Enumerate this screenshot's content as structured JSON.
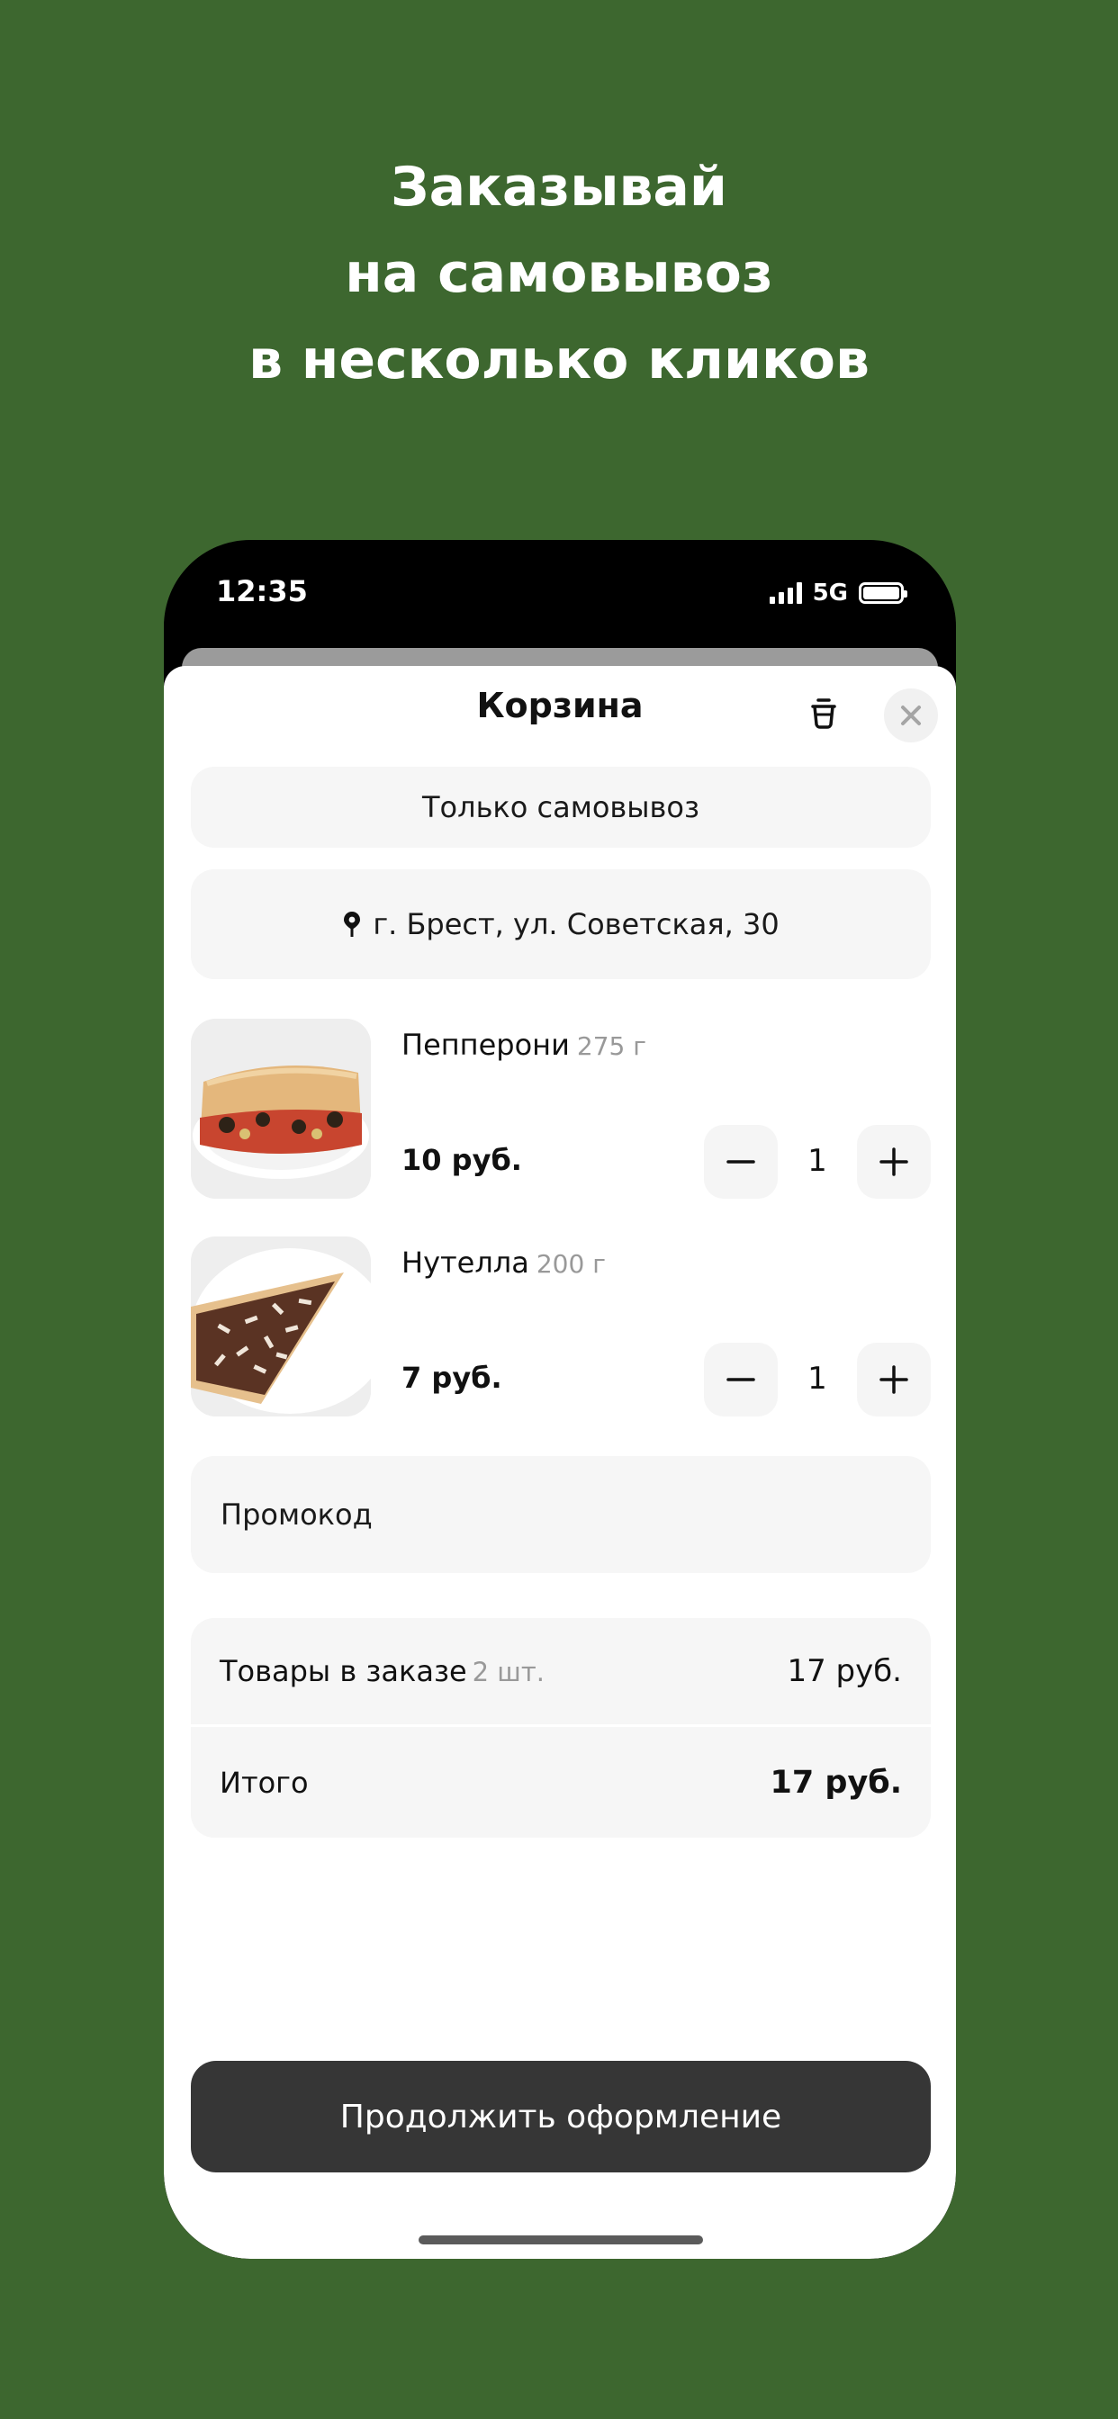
{
  "headline": {
    "line1": "Заказывай",
    "line2": "на самовывоз",
    "line3": "в несколько кликов"
  },
  "status_bar": {
    "time": "12:35",
    "network": "5G"
  },
  "cart": {
    "title": "Корзина",
    "pickup_notice": "Только самовывоз",
    "address": "г. Брест, ул. Советская, 30",
    "items": [
      {
        "name": "Пепперони",
        "weight": "275 г",
        "price": "10 руб.",
        "quantity": "1"
      },
      {
        "name": "Нутелла",
        "weight": "200 г",
        "price": "7 руб.",
        "quantity": "1"
      }
    ],
    "promo_label": "Промокод",
    "summary": {
      "items_label": "Товары в заказе",
      "items_count": "2 шт.",
      "items_value": "17 руб.",
      "total_label": "Итого",
      "total_value": "17 руб."
    },
    "continue_label": "Продолжить оформление"
  },
  "colors": {
    "background": "#3d672f",
    "button_dark": "#363636",
    "surface": "#f6f6f6"
  },
  "icons": [
    "trash-icon",
    "close-icon",
    "location-pin-icon",
    "minus-icon",
    "plus-icon",
    "signal-icon",
    "battery-icon"
  ]
}
